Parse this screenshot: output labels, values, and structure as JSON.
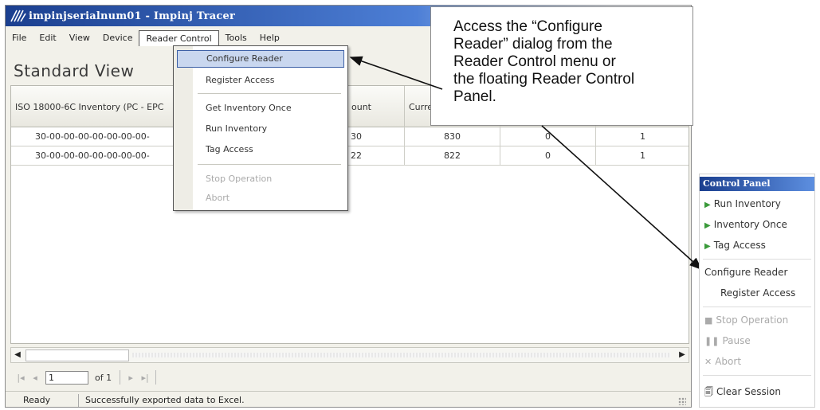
{
  "window": {
    "title": "impinjserialnum01 - Impinj Tracer"
  },
  "menubar": {
    "items": [
      "File",
      "Edit",
      "View",
      "Device",
      "Reader Control",
      "Tools",
      "Help"
    ]
  },
  "view_title": "Standard View",
  "table": {
    "columns": [
      "ISO 18000-6C Inventory (PC - EPC",
      "",
      "ount",
      "Current Read C",
      "",
      ""
    ],
    "rows": [
      [
        "30-00-00-00-00-00-00-00-",
        "",
        "30",
        "830",
        "0",
        "1"
      ],
      [
        "30-00-00-00-00-00-00-00-",
        "",
        "22",
        "822",
        "0",
        "1"
      ]
    ]
  },
  "dropdown": {
    "items": {
      "configure": "Configure Reader",
      "register": "Register Access",
      "get_once": "Get Inventory Once",
      "run": "Run Inventory",
      "tag": "Tag Access",
      "stop": "Stop Operation",
      "abort": "Abort"
    }
  },
  "pager": {
    "page": "1",
    "of_label": "of 1"
  },
  "status": {
    "ready": "Ready",
    "message": "Successfully exported data to Excel."
  },
  "callout": {
    "lines": [
      "Access the “Configure",
      "Reader” dialog from the",
      "Reader Control menu or",
      "the floating Reader Control",
      "Panel."
    ]
  },
  "control_panel": {
    "title": "Control Panel",
    "run_inventory": "Run Inventory",
    "inventory_once": "Inventory Once",
    "tag_access": "Tag Access",
    "configure_reader": "Configure Reader",
    "register_access": "Register Access",
    "stop_operation": "Stop Operation",
    "pause": "Pause",
    "abort": "Abort",
    "clear_session": "Clear Session"
  },
  "colors": {
    "title_gradient_start": "#1b3f8f",
    "menu_highlight": "#c9d7ef",
    "play_green": "#3a9a3a"
  }
}
